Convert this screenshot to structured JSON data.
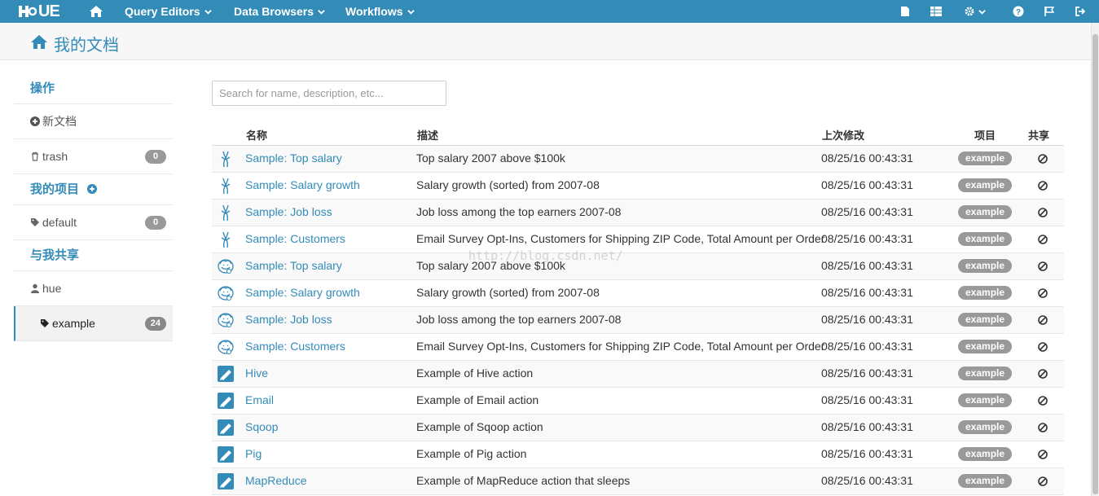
{
  "nav": {
    "logo_text": "UE",
    "menus": [
      {
        "label": "Query Editors"
      },
      {
        "label": "Data Browsers"
      },
      {
        "label": "Workflows"
      }
    ]
  },
  "header": {
    "title": "我的文档"
  },
  "sidebar": {
    "actions_title": "操作",
    "new_document": "新文档",
    "trash": {
      "label": "trash",
      "count": "0"
    },
    "projects_title": "我的项目",
    "default": {
      "label": "default",
      "count": "0"
    },
    "shared_title": "与我共享",
    "user": {
      "label": "hue"
    },
    "example": {
      "label": "example",
      "count": "24"
    }
  },
  "search": {
    "placeholder": "Search for name, description, etc..."
  },
  "table": {
    "columns": {
      "name": "名称",
      "description": "描述",
      "modified": "上次修改",
      "project": "项目",
      "share": "共享"
    },
    "rows": [
      {
        "icon": "beeswax-icon",
        "name": "Sample: Top salary",
        "description": "Top salary 2007 above $100k",
        "modified": "08/25/16 00:43:31",
        "project": "example"
      },
      {
        "icon": "beeswax-icon",
        "name": "Sample: Salary growth",
        "description": "Salary growth (sorted) from 2007-08",
        "modified": "08/25/16 00:43:31",
        "project": "example"
      },
      {
        "icon": "beeswax-icon",
        "name": "Sample: Job loss",
        "description": "Job loss among the top earners 2007-08",
        "modified": "08/25/16 00:43:31",
        "project": "example"
      },
      {
        "icon": "beeswax-icon",
        "name": "Sample: Customers",
        "description": "Email Survey Opt-Ins, Customers for Shipping ZIP Code, Total Amount per Order",
        "modified": "08/25/16 00:43:31",
        "project": "example"
      },
      {
        "icon": "impala-icon",
        "name": "Sample: Top salary",
        "description": "Top salary 2007 above $100k",
        "modified": "08/25/16 00:43:31",
        "project": "example"
      },
      {
        "icon": "impala-icon",
        "name": "Sample: Salary growth",
        "description": "Salary growth (sorted) from 2007-08",
        "modified": "08/25/16 00:43:31",
        "project": "example"
      },
      {
        "icon": "impala-icon",
        "name": "Sample: Job loss",
        "description": "Job loss among the top earners 2007-08",
        "modified": "08/25/16 00:43:31",
        "project": "example"
      },
      {
        "icon": "impala-icon",
        "name": "Sample: Customers",
        "description": "Email Survey Opt-Ins, Customers for Shipping ZIP Code, Total Amount per Order",
        "modified": "08/25/16 00:43:31",
        "project": "example"
      },
      {
        "icon": "oozie-icon",
        "name": "Hive",
        "description": "Example of Hive action",
        "modified": "08/25/16 00:43:31",
        "project": "example"
      },
      {
        "icon": "oozie-icon",
        "name": "Email",
        "description": "Example of Email action",
        "modified": "08/25/16 00:43:31",
        "project": "example"
      },
      {
        "icon": "oozie-icon",
        "name": "Sqoop",
        "description": "Example of Sqoop action",
        "modified": "08/25/16 00:43:31",
        "project": "example"
      },
      {
        "icon": "oozie-icon",
        "name": "Pig",
        "description": "Example of Pig action",
        "modified": "08/25/16 00:43:31",
        "project": "example"
      },
      {
        "icon": "oozie-icon",
        "name": "MapReduce",
        "description": "Example of MapReduce action that sleeps",
        "modified": "08/25/16 00:43:31",
        "project": "example"
      }
    ]
  },
  "watermark": "http://blog.csdn.net/",
  "colors": {
    "accent": "#338bb8",
    "badge": "#999999"
  }
}
